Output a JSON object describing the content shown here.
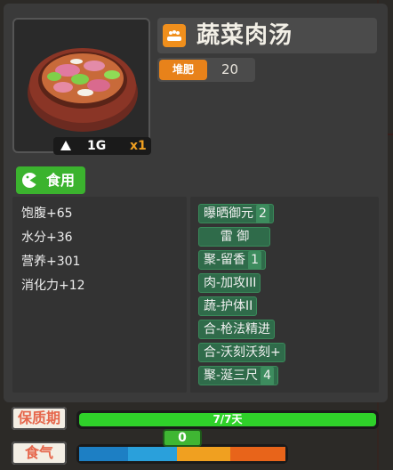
{
  "item": {
    "name": "蔬菜肉汤",
    "weight": "1G",
    "quantity": "x1",
    "compost_label": "堆肥",
    "compost_value": "20"
  },
  "action": {
    "eat_label": "食用"
  },
  "stats": [
    "饱腹+65",
    "水分+36",
    "营养+301",
    "消化力+12"
  ],
  "buffs": [
    {
      "label": "曝晒御元",
      "level": "2"
    },
    {
      "label": "雷 御",
      "level": ""
    },
    {
      "label": "聚-留香",
      "level": "1"
    },
    {
      "label": "肉-加攻III",
      "level": ""
    },
    {
      "label": "蔬-护体II",
      "level": ""
    },
    {
      "label": "合-枪法精进",
      "level": ""
    },
    {
      "label": "合-沃刻沃刻+",
      "level": ""
    },
    {
      "label": "聚-涎三尺",
      "level": "4"
    }
  ],
  "shelf_life": {
    "label": "保质期",
    "text": "7/7天",
    "fraction": 1.0
  },
  "appetite": {
    "label": "食气",
    "value": "0"
  },
  "colors": {
    "accent_orange": "#e8821a",
    "accent_green": "#3bb32e",
    "buff_bg": "#2f6b4a"
  }
}
